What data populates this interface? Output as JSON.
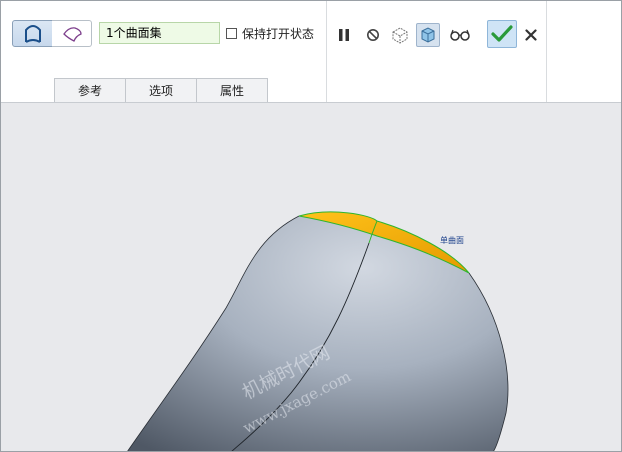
{
  "ribbon": {
    "collector_value": "1个曲面集",
    "keep_open_label": "保持打开状态",
    "keep_open_checked": false
  },
  "tabs": [
    {
      "label": "参考"
    },
    {
      "label": "选项"
    },
    {
      "label": "属性"
    }
  ],
  "viewport": {
    "annotation": "单曲面",
    "watermark_cn": "机械时代网",
    "watermark_url": "www.jxage.com"
  },
  "colors": {
    "highlight_surface": "#f2a600",
    "edge_green": "#2fb52f",
    "model_body": "#a9b3c1",
    "ok_check": "#2a9a3a"
  }
}
